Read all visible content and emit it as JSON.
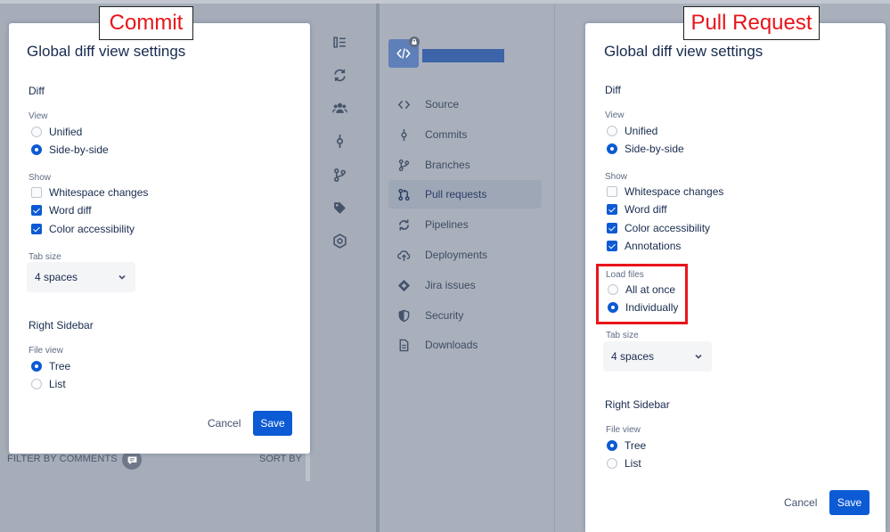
{
  "annotations": {
    "commit_label": "Commit",
    "pr_label": "Pull Request",
    "highlight_color": "#e8151b"
  },
  "colors": {
    "accent": "#0c5ad4",
    "overlay": "#97a0ae",
    "text": "#172b4d",
    "muted": "#5e6c84"
  },
  "background": {
    "rail_icons": [
      "sidebar-toggle-icon",
      "sync-icon",
      "people-icon",
      "commit-icon",
      "branch-icon",
      "tag-icon",
      "settings-gear-icon"
    ],
    "repo_icon": "code-icon",
    "nav": [
      {
        "label": "Source",
        "icon": "code-icon",
        "active": false
      },
      {
        "label": "Commits",
        "icon": "commit-icon",
        "active": false
      },
      {
        "label": "Branches",
        "icon": "branch-icon",
        "active": false
      },
      {
        "label": "Pull requests",
        "icon": "pull-request-icon",
        "active": true
      },
      {
        "label": "Pipelines",
        "icon": "pipelines-icon",
        "active": false
      },
      {
        "label": "Deployments",
        "icon": "cloud-upload-icon",
        "active": false
      },
      {
        "label": "Jira issues",
        "icon": "jira-icon",
        "active": false
      },
      {
        "label": "Security",
        "icon": "shield-icon",
        "active": false
      },
      {
        "label": "Downloads",
        "icon": "document-icon",
        "active": false
      }
    ],
    "filter_label": "FILTER BY COMMENTS",
    "filter_icon": "comment-icon",
    "sort_label": "SORT BY"
  },
  "commit_dialog": {
    "title": "Global diff view settings",
    "diff_heading": "Diff",
    "view_label": "View",
    "view_options": [
      {
        "label": "Unified",
        "selected": false
      },
      {
        "label": "Side-by-side",
        "selected": true
      }
    ],
    "show_label": "Show",
    "show_options": [
      {
        "label": "Whitespace changes",
        "checked": false
      },
      {
        "label": "Word diff",
        "checked": true
      },
      {
        "label": "Color accessibility",
        "checked": true
      }
    ],
    "tab_size_label": "Tab size",
    "tab_size_value": "4 spaces",
    "sidebar_heading": "Right Sidebar",
    "file_view_label": "File view",
    "file_view_options": [
      {
        "label": "Tree",
        "selected": true
      },
      {
        "label": "List",
        "selected": false
      }
    ],
    "cancel_label": "Cancel",
    "save_label": "Save"
  },
  "pr_dialog": {
    "title": "Global diff view settings",
    "diff_heading": "Diff",
    "view_label": "View",
    "view_options": [
      {
        "label": "Unified",
        "selected": false
      },
      {
        "label": "Side-by-side",
        "selected": true
      }
    ],
    "show_label": "Show",
    "show_options": [
      {
        "label": "Whitespace changes",
        "checked": false
      },
      {
        "label": "Word diff",
        "checked": true
      },
      {
        "label": "Color accessibility",
        "checked": true
      },
      {
        "label": "Annotations",
        "checked": true
      }
    ],
    "load_files_label": "Load files",
    "load_files_options": [
      {
        "label": "All at once",
        "selected": false
      },
      {
        "label": "Individually",
        "selected": true
      }
    ],
    "tab_size_label": "Tab size",
    "tab_size_value": "4 spaces",
    "sidebar_heading": "Right Sidebar",
    "file_view_label": "File view",
    "file_view_options": [
      {
        "label": "Tree",
        "selected": true
      },
      {
        "label": "List",
        "selected": false
      }
    ],
    "cancel_label": "Cancel",
    "save_label": "Save"
  }
}
